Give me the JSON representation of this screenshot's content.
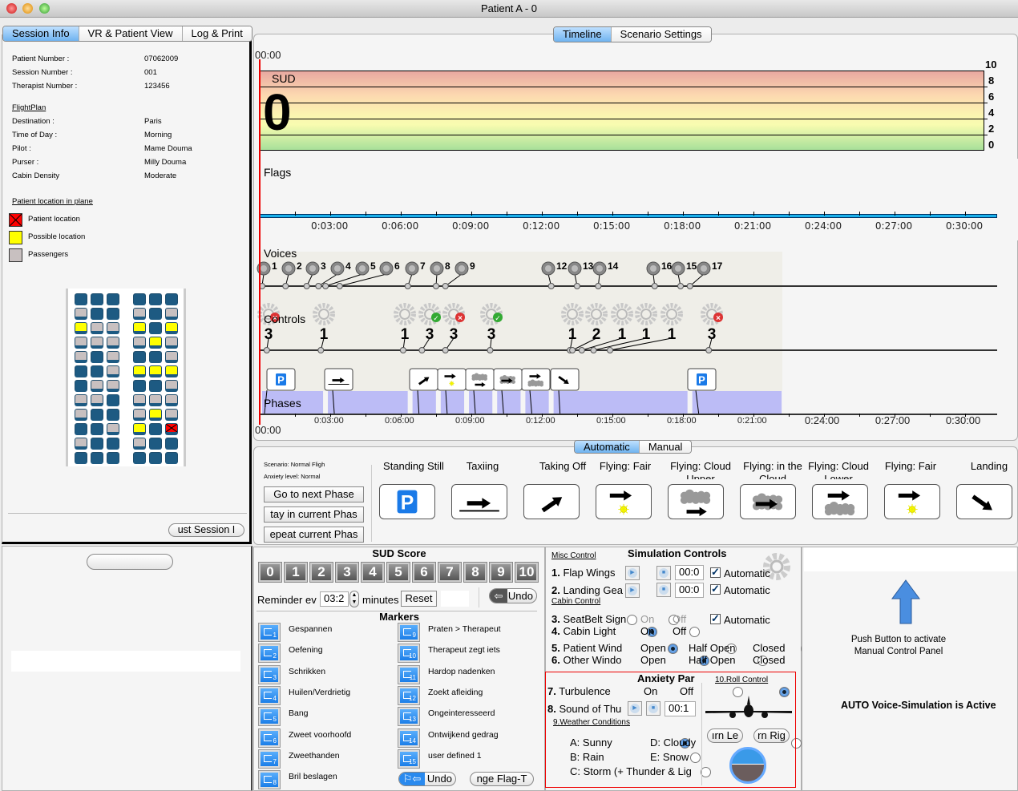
{
  "window": {
    "title": "Patient A  -  0"
  },
  "left_tabs": [
    {
      "label": "Session Info",
      "active": true
    },
    {
      "label": "VR & Patient View"
    },
    {
      "label": "Log & Print"
    }
  ],
  "session": {
    "fields": [
      {
        "label": "Patient Number :",
        "value": "07062009"
      },
      {
        "label": "Session Number :",
        "value": "001"
      },
      {
        "label": "Therapist Number :",
        "value": "123456"
      }
    ],
    "flightplan_heading": "FlightPlan",
    "flightplan": [
      {
        "label": "Destination :",
        "value": "Paris"
      },
      {
        "label": "Time of Day :",
        "value": "Morning"
      },
      {
        "label": "Pilot :",
        "value": "Mame Douma"
      },
      {
        "label": "Purser :",
        "value": "Milly Douma"
      },
      {
        "label": "Cabin Density",
        "value": "Moderate"
      }
    ],
    "location_heading": "Patient location in plane",
    "legend": [
      {
        "label": "Patient location",
        "color": "#ff0000"
      },
      {
        "label": "Possible location",
        "color": "#ffff00"
      },
      {
        "label": "Passengers",
        "color": "#c8c0c0"
      }
    ],
    "seats": [
      "bbbbbb",
      "gbbgbg",
      "yggyby",
      "gggqyg",
      "gbgbbg",
      "bbgyyy",
      "bggbbg",
      "ggbggg",
      "gbbgyg",
      "bbgybx",
      "gbbgbb",
      "bbbbbb"
    ],
    "adjust_button": "ust Session I"
  },
  "timeline_tabs": [
    {
      "label": "Timeline",
      "active": true
    },
    {
      "label": "Scenario Settings"
    }
  ],
  "timeline": {
    "start_time": "00:00",
    "sud_label": "SUD",
    "sud_value": "0",
    "sud_ticks": [
      "10",
      "8",
      "6",
      "4",
      "2",
      "0"
    ],
    "flags_label": "Flags",
    "voices_label": "Voices",
    "controls_label": "Controls",
    "phases_label": "Phases",
    "time_ticks": [
      "0:03:00",
      "0:06:00",
      "0:09:00",
      "0:12:00",
      "0:15:00",
      "0:18:00",
      "0:21:00",
      "0:24:00",
      "0:27:00",
      "0:30:00"
    ],
    "voices": [
      {
        "id": "1",
        "min": 0.1
      },
      {
        "id": "2",
        "min": 1.1
      },
      {
        "id": "3",
        "min": 2.0
      },
      {
        "id": "4",
        "min": 2.5
      },
      {
        "id": "5",
        "min": 2.8
      },
      {
        "id": "6",
        "min": 3.4
      },
      {
        "id": "7",
        "min": 6.3
      },
      {
        "id": "8",
        "min": 7.5
      },
      {
        "id": "9",
        "min": 7.9
      },
      {
        "id": "12",
        "min": 12.4
      },
      {
        "id": "13",
        "min": 13.5
      },
      {
        "id": "14",
        "min": 14.4
      },
      {
        "id": "16",
        "min": 16.8
      },
      {
        "id": "15",
        "min": 17.9
      },
      {
        "id": "17",
        "min": 18.3
      }
    ],
    "controls": [
      {
        "id": "3",
        "min": 0.3,
        "status": "fail"
      },
      {
        "id": "1",
        "min": 2.6,
        "status": ""
      },
      {
        "id": "1",
        "min": 6.1,
        "status": ""
      },
      {
        "id": "3",
        "min": 6.9,
        "status": "ok"
      },
      {
        "id": "3",
        "min": 7.9,
        "status": "fail"
      },
      {
        "id": "3",
        "min": 9.8,
        "status": "ok"
      },
      {
        "id": "1",
        "min": 13.2,
        "status": ""
      },
      {
        "id": "2",
        "min": 13.3,
        "status": ""
      },
      {
        "id": "1",
        "min": 13.7,
        "status": ""
      },
      {
        "id": "1",
        "min": 14.2,
        "status": ""
      },
      {
        "id": "1",
        "min": 14.9,
        "status": ""
      },
      {
        "id": "3",
        "min": 19.1,
        "status": "fail"
      }
    ],
    "phases": [
      {
        "icon": "parking",
        "start": 0.1
      },
      {
        "icon": "taxiing",
        "start": 2.9
      },
      {
        "icon": "takeoff",
        "start": 6.5
      },
      {
        "icon": "fair",
        "start": 7.7
      },
      {
        "icon": "cloud-upper",
        "start": 8.9
      },
      {
        "icon": "in-cloud",
        "start": 10.1
      },
      {
        "icon": "cloud-lower",
        "start": 11.3
      },
      {
        "icon": "landing",
        "start": 12.5
      },
      {
        "icon": "parking",
        "start": 18.4
      }
    ],
    "phases_end": 22.2
  },
  "mode_tabs": [
    {
      "label": "Automatic",
      "active": true
    },
    {
      "label": "Manual"
    }
  ],
  "phase_panel": {
    "scenario": "Scenario: Normal Fligh",
    "anxiety": "Anxiety level: Normal",
    "buttons": [
      "Go to next Phase",
      "tay in current Phas",
      "epeat current Phas"
    ],
    "phases": [
      {
        "label": "Standing Still",
        "icon": "parking"
      },
      {
        "label": "Taxiing",
        "icon": "taxiing"
      },
      {
        "label": "Taking Off",
        "icon": "takeoff"
      },
      {
        "label": "Flying: Fair",
        "icon": "fair"
      },
      {
        "label": "Flying: Cloud Upper",
        "icon": "cloud-upper"
      },
      {
        "label": "Flying: in the Cloud",
        "icon": "in-cloud"
      },
      {
        "label": "Flying: Cloud Lower",
        "icon": "cloud-lower"
      },
      {
        "label": "Flying: Fair",
        "icon": "fair"
      },
      {
        "label": "Landing",
        "icon": "landing"
      }
    ]
  },
  "sud_score": {
    "title": "SUD Score",
    "buttons": [
      "0",
      "1",
      "2",
      "3",
      "4",
      "5",
      "6",
      "7",
      "8",
      "9",
      "10"
    ],
    "reminder_label": "Reminder ev",
    "reminder_value": "03:2",
    "minutes_label": "minutes",
    "reset": "Reset",
    "undo": "Undo"
  },
  "markers": {
    "title": "Markers",
    "items": [
      {
        "n": "1",
        "label": "Gespannen"
      },
      {
        "n": "2",
        "label": "Oefening"
      },
      {
        "n": "3",
        "label": "Schrikken"
      },
      {
        "n": "4",
        "label": "Huilen/Verdrietig"
      },
      {
        "n": "5",
        "label": "Bang"
      },
      {
        "n": "6",
        "label": "Zweet voorhoofd"
      },
      {
        "n": "7",
        "label": "Zweethanden"
      },
      {
        "n": "8",
        "label": "Bril beslagen"
      },
      {
        "n": "9",
        "label": "Praten > Therapeut"
      },
      {
        "n": "10",
        "label": "Therapeut zegt iets"
      },
      {
        "n": "11",
        "label": "Hardop nadenken"
      },
      {
        "n": "12",
        "label": "Zoekt afleiding"
      },
      {
        "n": "13",
        "label": "Ongeinteresseerd"
      },
      {
        "n": "14",
        "label": "Ontwijkend gedrag"
      },
      {
        "n": "15",
        "label": "user defined 1"
      }
    ],
    "undo": "Undo",
    "change_flag": "nge Flag-T"
  },
  "sim": {
    "title": "Simulation Controls",
    "misc": "Misc Control",
    "flap": {
      "label": "Flap Wings",
      "n": "1.",
      "time": "00:0",
      "auto": "Automatic"
    },
    "gear": {
      "label": "Landing Gea",
      "n": "2.",
      "time": "00:0",
      "auto": "Automatic"
    },
    "cabin": "Cabin Control",
    "seatbelt": {
      "n": "3.",
      "label": "SeatBelt Sign",
      "on": "On",
      "off": "Off",
      "auto": "Automatic"
    },
    "light": {
      "n": "4.",
      "label": "Cabin Light",
      "on": "On",
      "off": "Off"
    },
    "pwin": {
      "n": "5.",
      "label": "Patient Wind",
      "open": "Open",
      "half": "Half Open",
      "closed": "Closed"
    },
    "owin": {
      "n": "6.",
      "label": "Other Windo",
      "open": "Open",
      "half": "Half Open",
      "closed": "Closed"
    },
    "anxiety_title": "Anxiety Par",
    "turb": {
      "n": "7.",
      "label": "Turbulence",
      "on": "On",
      "off": "Off"
    },
    "thunder": {
      "n": "8.",
      "label": "Sound of Thu",
      "time": "00:1"
    },
    "weather_title": "9.Weather Conditions",
    "weather": {
      "a": "A: Sunny",
      "b": "B: Rain",
      "c": "C: Storm (+ Thunder & Lig",
      "d": "D: Cloudy",
      "e": "E: Snow"
    },
    "roll_title": "10.Roll Control",
    "turn_left": "ırn Le",
    "turn_right": "rn Rig"
  },
  "right": {
    "push_text1": "Push Button to activate",
    "push_text2": "Manual Control Panel",
    "status": "AUTO Voice-Simulation is Active"
  }
}
